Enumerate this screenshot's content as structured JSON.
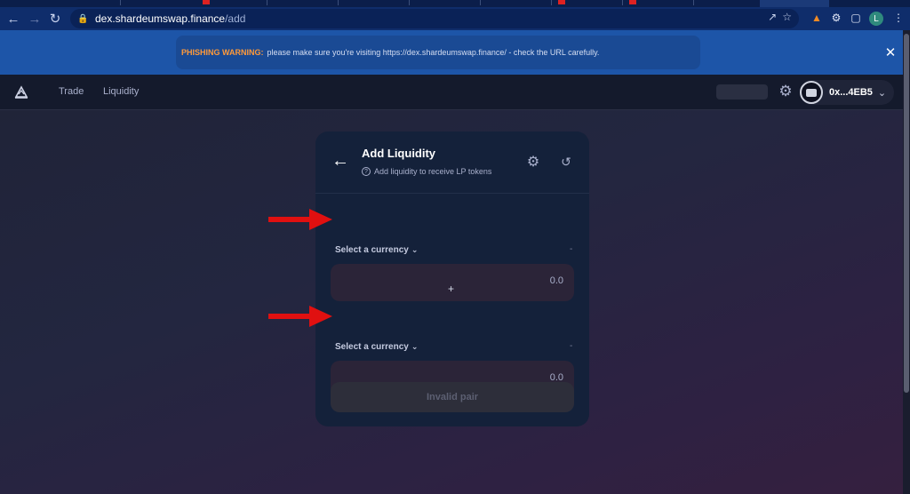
{
  "browser": {
    "url_host": "dex.shardeumswap.finance",
    "url_path": "/add",
    "profile_initial": "L"
  },
  "banner": {
    "warning_label": "PHISHING WARNING:",
    "warning_message": "please make sure you're visiting https://dex.shardeumswap.finance/ - check the URL carefully."
  },
  "nav": {
    "links": [
      "Trade",
      "Liquidity"
    ],
    "wallet_address": "0x...4EB5"
  },
  "card": {
    "title": "Add Liquidity",
    "subtitle": "Add liquidity to receive LP tokens",
    "token_a": {
      "select_label": "Select a currency",
      "balance": "-",
      "amount": "0.0"
    },
    "plus": "+",
    "token_b": {
      "select_label": "Select a currency",
      "balance": "-",
      "amount": "0.0"
    },
    "submit_label": "Invalid pair"
  },
  "colors": {
    "accent_warning": "#ff9a3a",
    "annotation_arrow": "#e01010",
    "card_bg": "#14213a"
  }
}
